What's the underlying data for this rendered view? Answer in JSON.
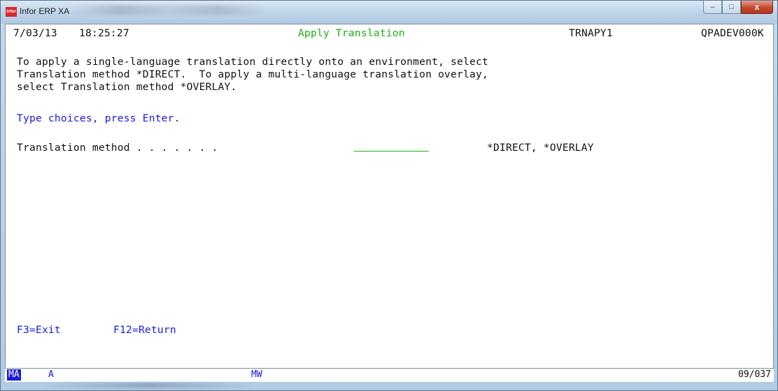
{
  "window": {
    "title": "Infor ERP XA",
    "app_icon_label": "Infor",
    "controls": {
      "minimize": "–",
      "maximize": "□",
      "close": "x"
    }
  },
  "header": {
    "date": "7/03/13",
    "time": "18:25:27",
    "title": "Apply Translation",
    "program": "TRNAPY1",
    "device": "QPADEV000K"
  },
  "instructions": [
    "To apply a single-language translation directly onto an environment, select",
    "Translation method *DIRECT.  To apply a multi-language translation overlay,",
    "select Translation method *OVERLAY."
  ],
  "prompt": "Type choices, press Enter.",
  "field": {
    "label": "Translation method . . . . . . .",
    "value": "",
    "allowed_values": "*DIRECT, *OVERLAY"
  },
  "function_keys": {
    "f3": "F3=Exit",
    "f12": "F12=Return"
  },
  "status": {
    "ma": "MA",
    "a": "A",
    "mw": "MW",
    "cursor_pos": "09/037"
  },
  "colors": {
    "green": "#1fae16",
    "blue": "#1a1ad6",
    "text": "#111111"
  }
}
